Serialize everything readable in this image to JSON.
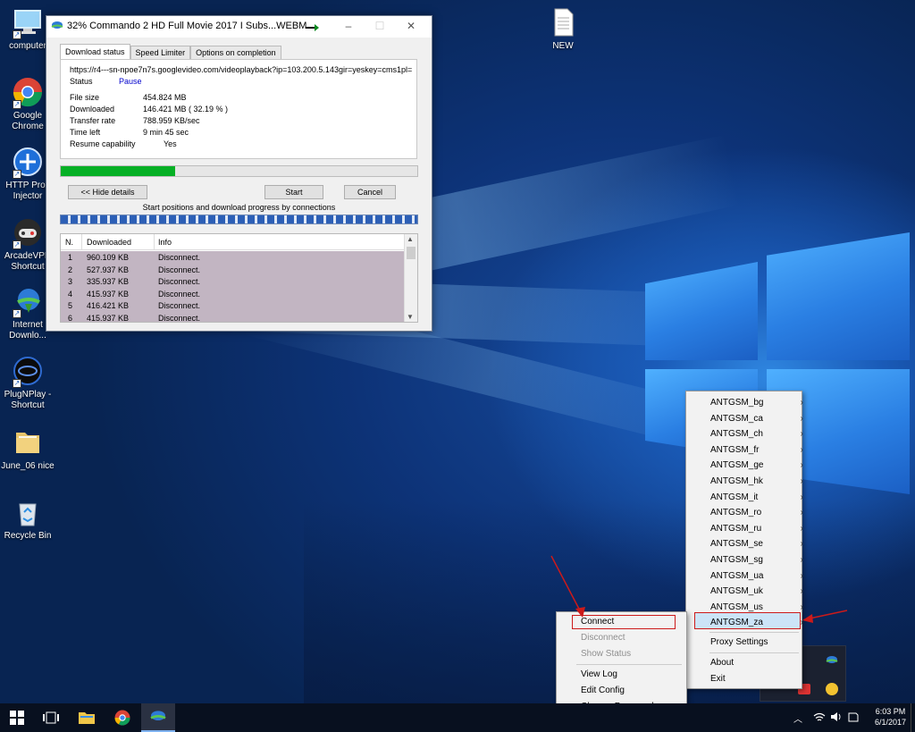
{
  "desktop_icons": [
    {
      "label": "computer",
      "icon": "computer-icon"
    },
    {
      "label": "Google Chrome",
      "icon": "chrome-icon"
    },
    {
      "label": "HTTP Prox Injector",
      "icon": "http-proxy-injector-icon"
    },
    {
      "label": "ArcadeVPN Shortcut",
      "icon": "arcadevpn-icon"
    },
    {
      "label": "Internet Downlo...",
      "icon": "internet-download-manager-icon"
    },
    {
      "label": "PlugNPlay - Shortcut",
      "icon": "plugnplay-icon"
    },
    {
      "label": "June_06 nice",
      "icon": "folder-icon"
    },
    {
      "label": "Recycle Bin",
      "icon": "recycle-bin-icon"
    },
    {
      "label": "NEW",
      "icon": "text-file-icon"
    }
  ],
  "idm": {
    "title": "32% Commando 2 HD Full Movie 2017 I Subs...WEBM",
    "tabs": [
      "Download status",
      "Speed Limiter",
      "Options on completion"
    ],
    "url": "https://r4---sn-npoe7n7s.googlevideo.com/videoplayback?ip=103.200.5.143gir=yeskey=cms1pl=",
    "status_label": "Status",
    "status_value": "Pause",
    "fields": [
      {
        "label": "File size",
        "value": "454.824  MB"
      },
      {
        "label": "Downloaded",
        "value": "146.421  MB  ( 32.19 % )"
      },
      {
        "label": "Transfer rate",
        "value": "788.959  KB/sec"
      },
      {
        "label": "Time left",
        "value": "9 min 45 sec"
      },
      {
        "label": "Resume capability",
        "value": "Yes"
      }
    ],
    "progress_fraction": 0.32,
    "buttons": {
      "hide_details": "<< Hide details",
      "start": "Start",
      "cancel": "Cancel"
    },
    "connections_caption": "Start positions and download progress by connections",
    "columns": [
      "N.",
      "Downloaded",
      "Info"
    ],
    "rows": [
      {
        "n": "1",
        "downloaded": "960.109  KB",
        "info": "Disconnect."
      },
      {
        "n": "2",
        "downloaded": "527.937  KB",
        "info": "Disconnect."
      },
      {
        "n": "3",
        "downloaded": "335.937  KB",
        "info": "Disconnect."
      },
      {
        "n": "4",
        "downloaded": "415.937  KB",
        "info": "Disconnect."
      },
      {
        "n": "5",
        "downloaded": "416.421  KB",
        "info": "Disconnect."
      },
      {
        "n": "6",
        "downloaded": "415.937  KB",
        "info": "Disconnect."
      }
    ]
  },
  "server_menu": {
    "items": [
      "ANTGSM_bg",
      "ANTGSM_ca",
      "ANTGSM_ch",
      "ANTGSM_fr",
      "ANTGSM_ge",
      "ANTGSM_hk",
      "ANTGSM_it",
      "ANTGSM_ro",
      "ANTGSM_ru",
      "ANTGSM_se",
      "ANTGSM_sg",
      "ANTGSM_ua",
      "ANTGSM_uk",
      "ANTGSM_us",
      "ANTGSM_za"
    ],
    "selected": "ANTGSM_za",
    "bottom_items": [
      "Proxy Settings",
      "About",
      "Exit"
    ]
  },
  "submenu": {
    "items": [
      {
        "label": "Connect",
        "enabled": true
      },
      {
        "label": "Disconnect",
        "enabled": false
      },
      {
        "label": "Show Status",
        "enabled": false
      },
      {
        "label": "View Log",
        "enabled": true
      },
      {
        "label": "Edit Config",
        "enabled": true
      },
      {
        "label": "Change Password",
        "enabled": true
      }
    ]
  },
  "taskbar": {
    "time": "6:03 PM",
    "date": "6/1/2017",
    "pinned": [
      "start-icon",
      "task-view-icon",
      "file-explorer-icon",
      "chrome-icon",
      "idm-icon"
    ]
  },
  "colors": {
    "accent_green": "#06b025",
    "highlight_red": "#cc1a1a",
    "link_blue": "#0000cc"
  }
}
